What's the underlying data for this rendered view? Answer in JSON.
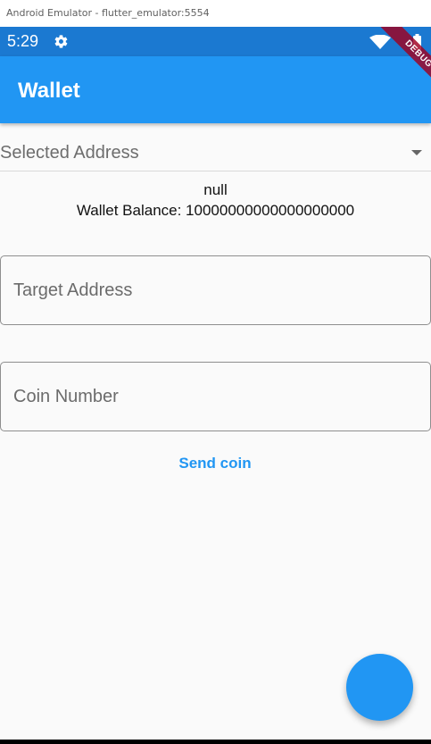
{
  "window": {
    "title": "Android Emulator - flutter_emulator:5554"
  },
  "status_bar": {
    "time": "5:29",
    "icons": [
      "settings-icon",
      "wifi-icon",
      "battery-icon"
    ]
  },
  "app_bar": {
    "title": "Wallet",
    "debug_banner": "DEBUG"
  },
  "main": {
    "dropdown": {
      "label": "Selected Address"
    },
    "address": "null",
    "balance": "Wallet Balance: 10000000000000000000",
    "target_field": {
      "placeholder": "Target Address",
      "value": ""
    },
    "coin_field": {
      "placeholder": "Coin Number",
      "value": ""
    },
    "send_button": "Send coin"
  },
  "colors": {
    "status_bar": "#1b79d1",
    "app_bar": "#2196f3",
    "primary": "#2196f3",
    "background": "#fafafa",
    "debug_banner": "#a00020"
  }
}
